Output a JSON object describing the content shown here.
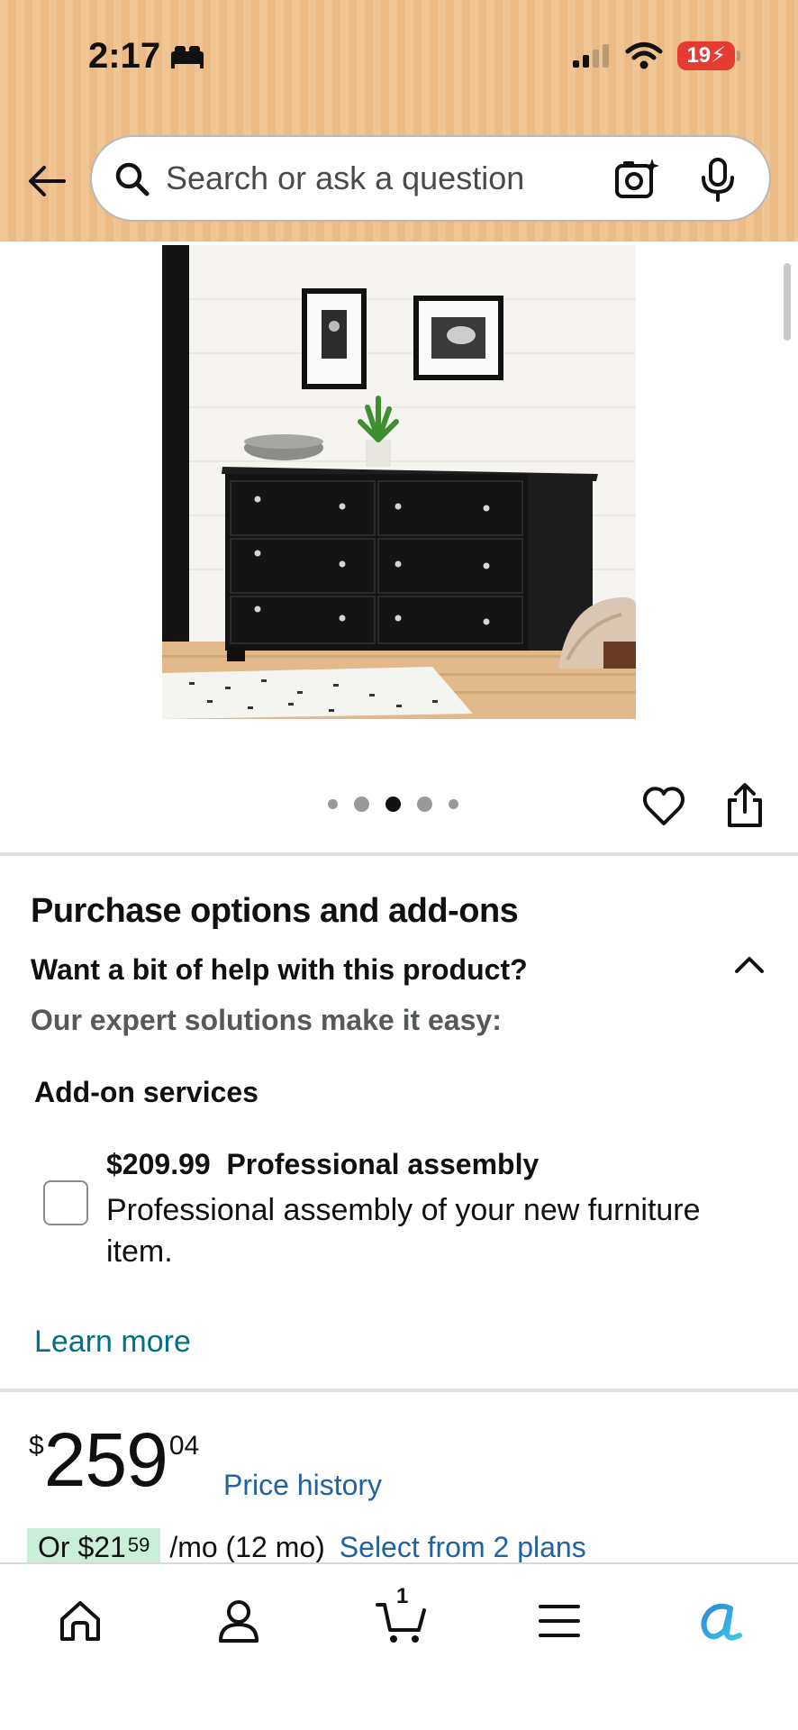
{
  "status_bar": {
    "time": "2:17",
    "battery": "19"
  },
  "search": {
    "placeholder": "Search or ask a question"
  },
  "product": {
    "image_alt": "Black six-drawer dresser",
    "gallery_count": 5,
    "gallery_active_index": 2
  },
  "purchase_options": {
    "title": "Purchase options and add-ons",
    "help_text": "Want a bit of help with this product?",
    "expert_text": "Our expert solutions make it easy:",
    "addon_heading": "Add-on services",
    "addon": {
      "price": "$209.99",
      "name": "Professional assembly",
      "description": "Professional assembly of your new furniture item.",
      "checked": false
    },
    "learn_more": "Learn more"
  },
  "price": {
    "symbol": "$",
    "whole": "259",
    "fraction": "04",
    "history_link": "Price history"
  },
  "monthly": {
    "prefix": "Or $",
    "whole": "21",
    "cents": "59",
    "term": "/mo (12 mo)",
    "plans_link": "Select from 2 plans"
  },
  "bottom_nav": {
    "cart_count": "1",
    "items": [
      "home-icon",
      "account-icon",
      "cart-icon",
      "menu-icon",
      "rufus-icon"
    ]
  },
  "colors": {
    "header_bg": "#f1c593",
    "link_teal": "#007185",
    "link_blue": "#2162a1",
    "battery_red": "#e53b30",
    "monthly_green": "#c9efd8"
  }
}
